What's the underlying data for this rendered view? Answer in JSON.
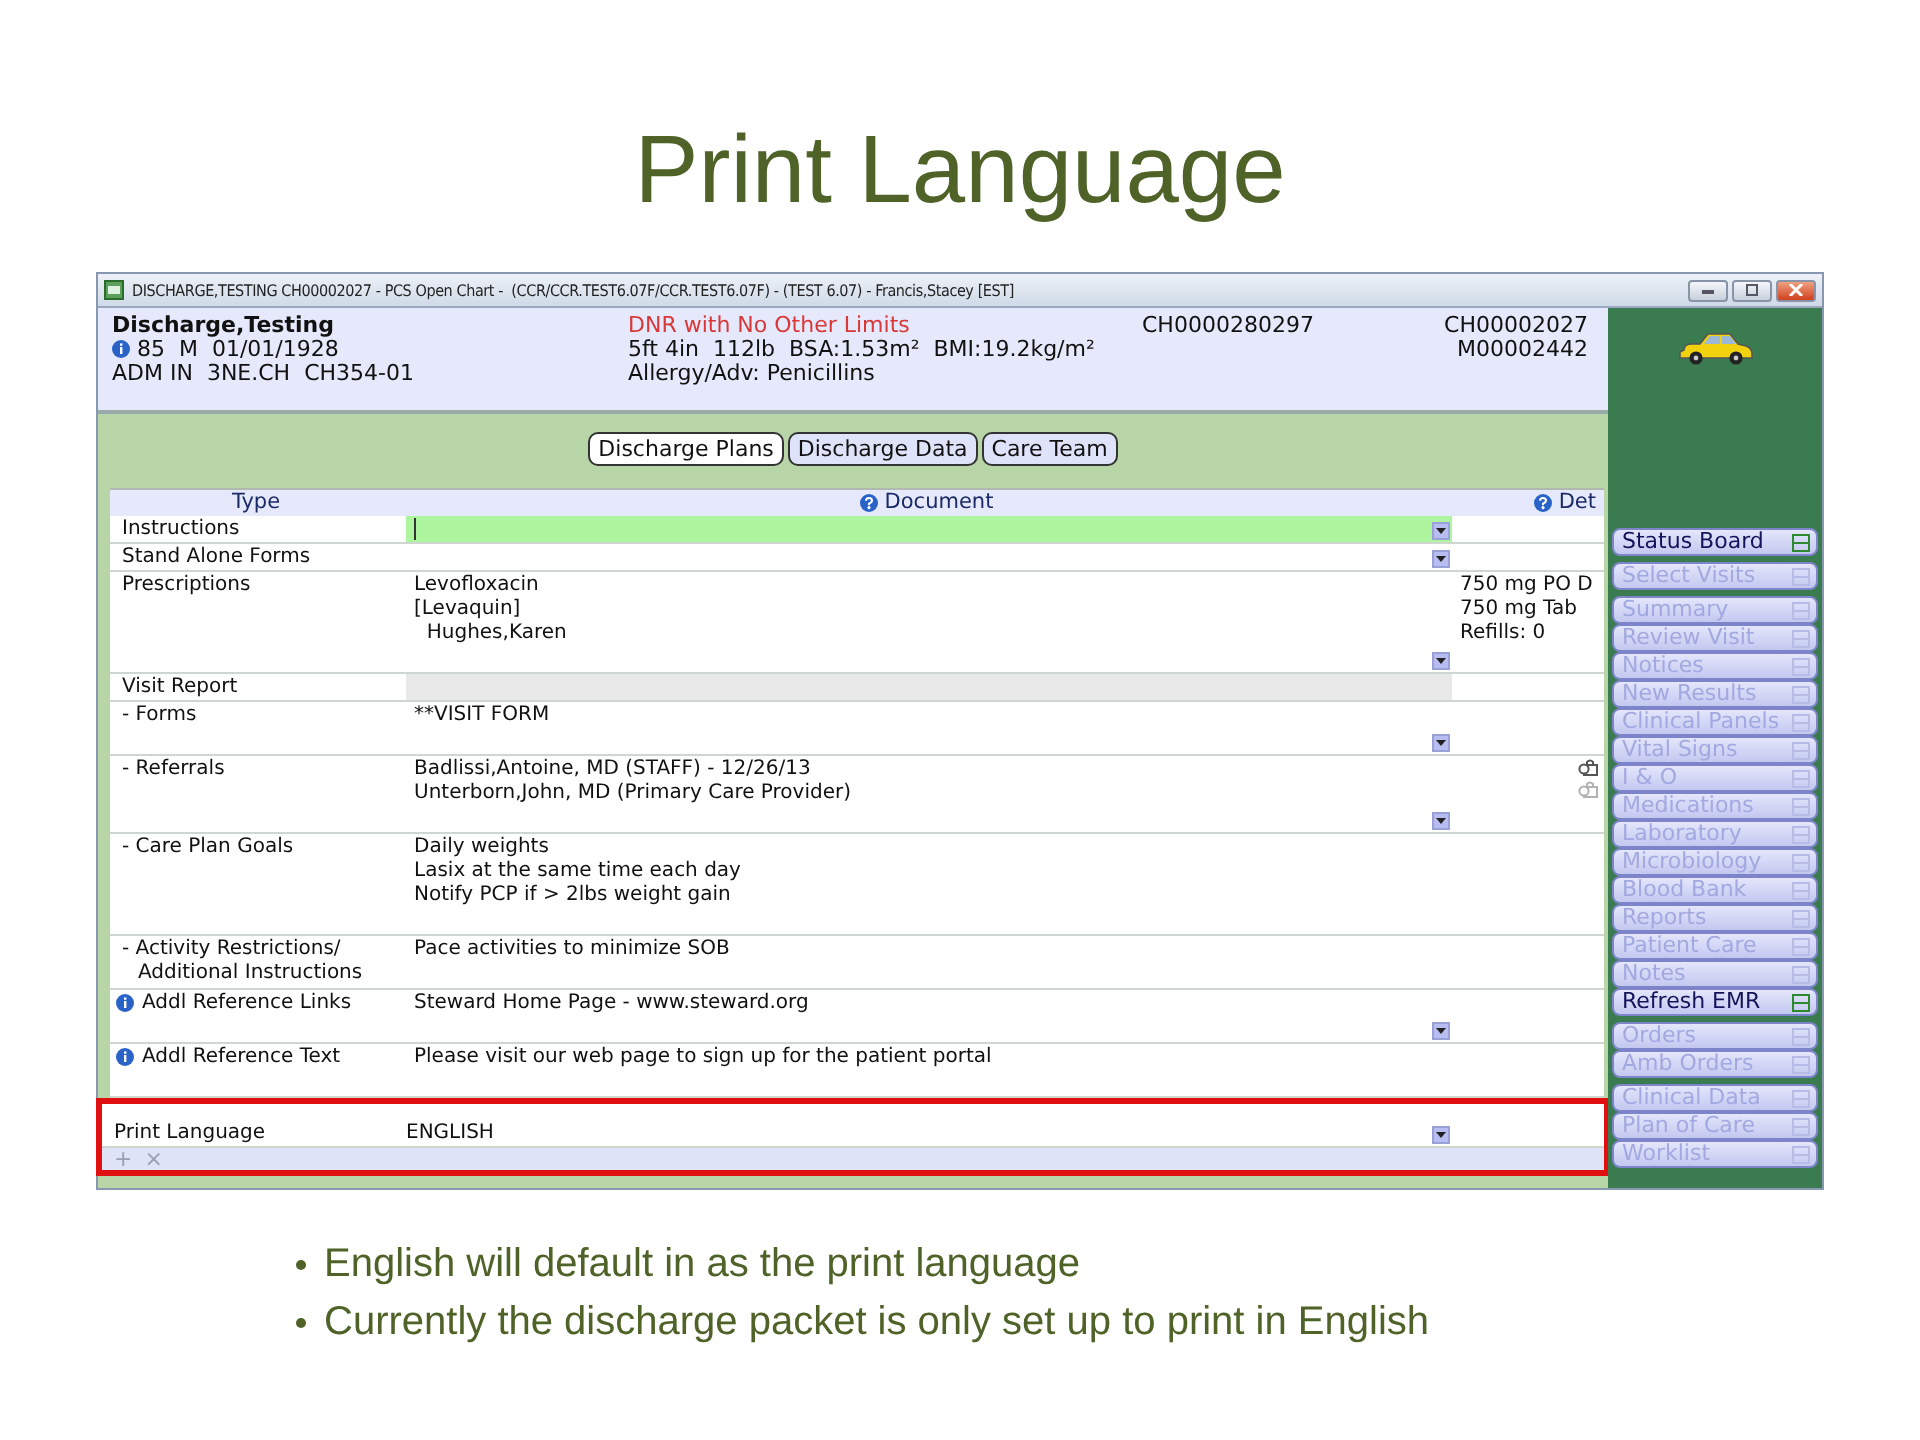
{
  "slide_title": "Print Language",
  "window": {
    "title": "DISCHARGE,TESTING CH00002027 - PCS Open Chart -  (CCR/CCR.TEST6.07F/CCR.TEST6.07F) - (TEST 6.07) - Francis,Stacey [EST]"
  },
  "patient": {
    "name": "Discharge,Testing",
    "demographics": "85  M  01/01/1928",
    "location": "ADM IN  3NE.CH  CH354-01",
    "code_status": "DNR with No Other Limits",
    "measurements": "5ft 4in  112lb  BSA:1.53m²  BMI:19.2kg/m²",
    "allergy": "Allergy/Adv: Penicillins",
    "account": "CH0000280297",
    "ids": [
      "CH00002027",
      "M00002442"
    ]
  },
  "tabs": [
    {
      "label": "Discharge Plans",
      "selected": true
    },
    {
      "label": "Discharge Data",
      "selected": false
    },
    {
      "label": "Care Team",
      "selected": false
    }
  ],
  "table": {
    "columns": [
      "Type",
      "Document",
      "Det"
    ],
    "rows": [
      {
        "kind": "plain",
        "type": "Instructions",
        "active": true,
        "dropdown": true,
        "outlined": false
      },
      {
        "kind": "plain",
        "type": "Stand Alone Forms",
        "active": false,
        "dropdown": true,
        "outlined": false
      },
      {
        "kind": "plain",
        "type": "Prescriptions",
        "document": [
          "Levofloxacin",
          "[Levaquin]",
          "  Hughes,Karen"
        ],
        "detail": [
          "750 mg PO D",
          "750 mg Tab",
          "Refills: 0"
        ],
        "active": false,
        "dropdown": true,
        "outlined": false
      },
      {
        "kind": "section",
        "type": "Visit Report",
        "active": false,
        "dropdown": false,
        "outlined": false
      },
      {
        "kind": "child",
        "type": "- Forms",
        "document": [
          "**VISIT FORM"
        ],
        "active": false,
        "dropdown": true,
        "outlined": false
      },
      {
        "kind": "child",
        "type": "- Referrals",
        "document": [
          "Badlissi,Antoine, MD (STAFF) - 12/26/13",
          "Unterborn,John, MD (Primary Care Provider)"
        ],
        "lock_icons": true,
        "active": false,
        "dropdown": true,
        "outlined": false
      },
      {
        "kind": "child",
        "type": "- Care Plan Goals",
        "document": [
          "Daily weights",
          "Lasix at the same time each day",
          "Notify PCP if > 2lbs weight gain"
        ],
        "active": false,
        "dropdown": false,
        "outlined": false
      },
      {
        "kind": "child",
        "type": "- Activity Restrictions/ Additional Instructions",
        "document": [
          "Pace activities to minimize SOB"
        ],
        "active": false,
        "dropdown": false,
        "outlined": false
      },
      {
        "kind": "info",
        "type": "Addl Reference Links",
        "document": [
          "Steward Home Page - www.steward.org"
        ],
        "active": false,
        "dropdown": true,
        "outlined": false
      },
      {
        "kind": "info",
        "type": "Addl Reference Text",
        "document": [
          "Please visit our web page to sign up for the patient portal"
        ],
        "active": false,
        "dropdown": false,
        "outlined": false
      },
      {
        "kind": "plain",
        "type": "Print Language",
        "document": [
          "ENGLISH"
        ],
        "active": false,
        "dropdown": true,
        "outlined": true
      }
    ],
    "row_actions": [
      "+",
      "×"
    ]
  },
  "sidebar": [
    {
      "items": [
        {
          "label": "Status Board",
          "disabled": false
        }
      ]
    },
    {
      "items": [
        {
          "label": "Select Visits",
          "disabled": true
        }
      ]
    },
    {
      "items": [
        {
          "label": "Summary",
          "disabled": true
        },
        {
          "label": "Review Visit",
          "disabled": true
        },
        {
          "label": "Notices",
          "disabled": true
        },
        {
          "label": "New Results",
          "disabled": true
        },
        {
          "label": "Clinical Panels",
          "disabled": true
        },
        {
          "label": "Vital Signs",
          "disabled": true
        },
        {
          "label": "I & O",
          "disabled": true
        },
        {
          "label": "Medications",
          "disabled": true
        },
        {
          "label": "Laboratory",
          "disabled": true
        },
        {
          "label": "Microbiology",
          "disabled": true
        },
        {
          "label": "Blood Bank",
          "disabled": true
        },
        {
          "label": "Reports",
          "disabled": true
        },
        {
          "label": "Patient Care",
          "disabled": true
        },
        {
          "label": "Notes",
          "disabled": true
        },
        {
          "label": "Refresh EMR",
          "disabled": false
        }
      ]
    },
    {
      "items": [
        {
          "label": "Orders",
          "disabled": true
        },
        {
          "label": "Amb Orders",
          "disabled": true
        }
      ]
    },
    {
      "items": [
        {
          "label": "Clinical Data",
          "disabled": true
        },
        {
          "label": "Plan of Care",
          "disabled": true
        },
        {
          "label": "Worklist",
          "disabled": true
        }
      ]
    }
  ],
  "bullets": [
    "English will default in as the print language",
    "Currently the discharge packet is only set up to print in English"
  ]
}
